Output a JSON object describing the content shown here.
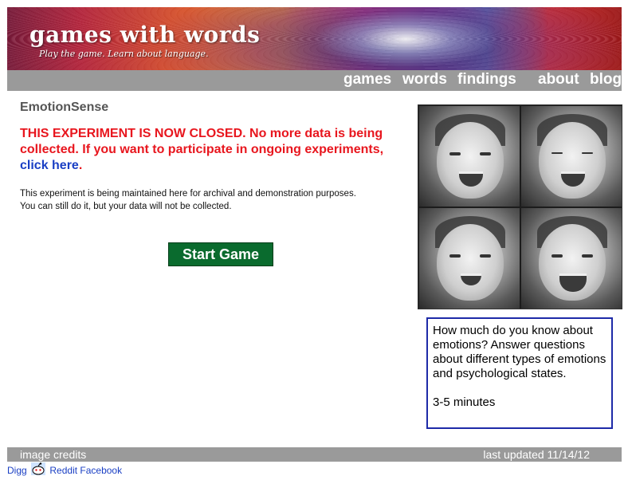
{
  "banner": {
    "logo_text": "games with words",
    "tagline": "Play the game. Learn about language."
  },
  "nav": {
    "items": [
      "games",
      "words",
      "findings",
      "about",
      "blog"
    ]
  },
  "main": {
    "title": "EmotionSense",
    "closed_notice": "THIS EXPERIMENT IS NOW CLOSED. No more data is being collected. If you want to participate in ongoing experiments,",
    "closed_link": "click here",
    "closed_suffix": ".",
    "description_line1": "This experiment is being maintained here for archival and demonstration purposes.",
    "description_line2": "You can still do it, but your data will not be collected.",
    "start_button": "Start Game"
  },
  "infobox": {
    "text": "How much do you know about emotions? Answer questions about different types of emotions and psychological states.",
    "duration": "3-5 minutes"
  },
  "footer": {
    "credits": "image credits",
    "updated": "last updated 11/14/12"
  },
  "social": {
    "digg": "Digg",
    "reddit": "Reddit",
    "facebook": "Facebook"
  },
  "colors": {
    "nav_bg": "#9a9a9a",
    "closed_red": "#e8161e",
    "link_blue": "#1a3fc4",
    "button_green": "#0a6b2e",
    "infobox_border": "#1e2aa8"
  }
}
